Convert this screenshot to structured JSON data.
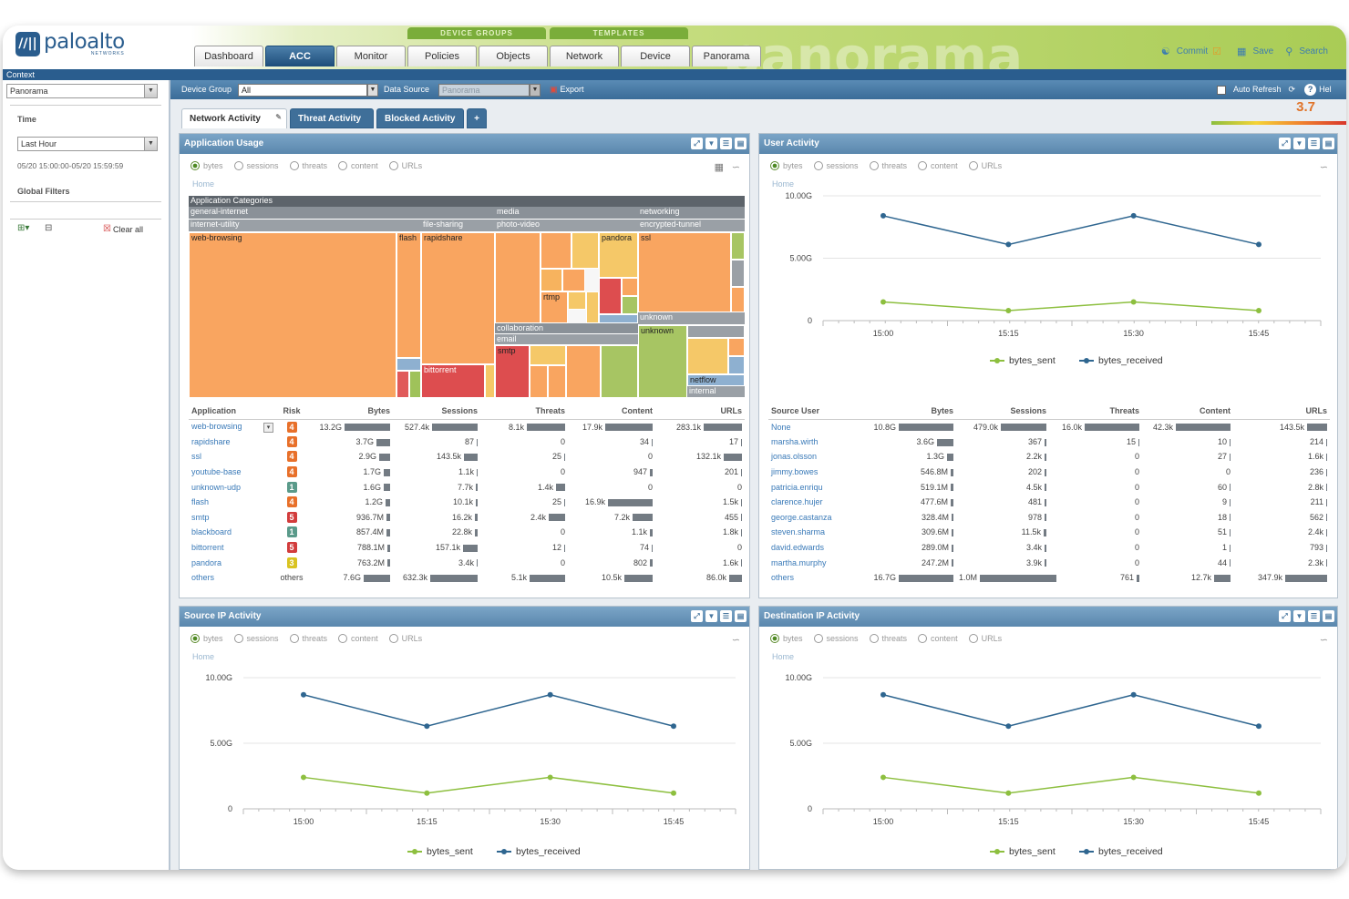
{
  "header": {
    "logo_name": "paloalto",
    "logo_sub": "NETWORKS",
    "logo_mark": "//||",
    "bg_word": "panorama",
    "group_device": "DEVICE GROUPS",
    "group_templates": "TEMPLATES",
    "tabs": [
      {
        "label": "Dashboard"
      },
      {
        "label": "ACC"
      },
      {
        "label": "Monitor"
      },
      {
        "label": "Policies"
      },
      {
        "label": "Objects"
      },
      {
        "label": "Network"
      },
      {
        "label": "Device"
      },
      {
        "label": "Panorama"
      }
    ],
    "active_tab": "ACC",
    "links": {
      "commit": "Commit",
      "save": "Save",
      "search": "Search"
    }
  },
  "context": {
    "label": "Context",
    "value": "Panorama"
  },
  "left": {
    "time_label": "Time",
    "time_value": "Last Hour",
    "time_range": "05/20 15:00:00-05/20 15:59:59",
    "filters_label": "Global Filters",
    "clear_all": "Clear all"
  },
  "toolbar": {
    "device_group_label": "Device Group",
    "device_group_value": "All",
    "data_source_label": "Data Source",
    "data_source_value": "Panorama",
    "export": "Export",
    "auto_refresh": "Auto Refresh",
    "help": "Help"
  },
  "subtabs": [
    "Network Activity",
    "Threat Activity",
    "Blocked Activity",
    "+"
  ],
  "risk_value": "3.7",
  "radios": [
    "bytes",
    "sessions",
    "threats",
    "content",
    "URLs"
  ],
  "home": "Home",
  "app_usage": {
    "title": "Application Usage",
    "treemap_labels": {
      "root": "Application Categories",
      "general_internet": "general-internet",
      "media": "media",
      "networking": "networking",
      "internet_utility": "internet-utility",
      "file_sharing": "file-sharing",
      "photo_video": "photo-video",
      "encrypted_tunnel": "encrypted-tunnel",
      "web_browsing": "web-browsing",
      "flash": "flash",
      "rapidshare": "rapidshare",
      "pandora": "pandora",
      "ssl": "ssl",
      "rtmp": "rtmp",
      "unknown1": "unknown",
      "unknown2": "unknown",
      "collaboration": "collaboration",
      "email": "email",
      "smtp": "smtp",
      "bittorrent": "bittorrent",
      "netflow": "netflow",
      "internal": "internal"
    },
    "columns": [
      "Application",
      "Risk",
      "Bytes",
      "Sessions",
      "Threats",
      "Content",
      "URLs"
    ],
    "rows": [
      {
        "name": "web-browsing",
        "risk": "4",
        "bytes": "13.2G",
        "sessions": "527.4k",
        "threats": "8.1k",
        "content": "17.9k",
        "urls": "283.1k",
        "b": [
          1,
          0.97,
          0.8,
          1,
          1
        ]
      },
      {
        "name": "rapidshare",
        "risk": "4",
        "bytes": "3.7G",
        "sessions": "87",
        "threats": "0",
        "content": "34",
        "urls": "17",
        "b": [
          0.3,
          0.02,
          0,
          0.02,
          0.02
        ]
      },
      {
        "name": "ssl",
        "risk": "4",
        "bytes": "2.9G",
        "sessions": "143.5k",
        "threats": "25",
        "content": "0",
        "urls": "132.1k",
        "b": [
          0.24,
          0.28,
          0.02,
          0,
          0.47
        ]
      },
      {
        "name": "youtube-base",
        "risk": "4",
        "bytes": "1.7G",
        "sessions": "1.1k",
        "threats": "0",
        "content": "947",
        "urls": "201",
        "b": [
          0.14,
          0.02,
          0,
          0.06,
          0.02
        ]
      },
      {
        "name": "unknown-udp",
        "risk": "1",
        "bytes": "1.6G",
        "sessions": "7.7k",
        "threats": "1.4k",
        "content": "0",
        "urls": "0",
        "b": [
          0.13,
          0.03,
          0.2,
          0,
          0
        ]
      },
      {
        "name": "flash",
        "risk": "4",
        "bytes": "1.2G",
        "sessions": "10.1k",
        "threats": "25",
        "content": "16.9k",
        "urls": "1.5k",
        "b": [
          0.1,
          0.04,
          0.02,
          0.95,
          0.02
        ]
      },
      {
        "name": "smtp",
        "risk": "5",
        "bytes": "936.7M",
        "sessions": "16.2k",
        "threats": "2.4k",
        "content": "7.2k",
        "urls": "455",
        "b": [
          0.08,
          0.05,
          0.35,
          0.42,
          0.02
        ]
      },
      {
        "name": "blackboard",
        "risk": "1",
        "bytes": "857.4M",
        "sessions": "22.8k",
        "threats": "0",
        "content": "1.1k",
        "urls": "1.8k",
        "b": [
          0.07,
          0.06,
          0,
          0.06,
          0.02
        ]
      },
      {
        "name": "bittorrent",
        "risk": "5",
        "bytes": "788.1M",
        "sessions": "157.1k",
        "threats": "12",
        "content": "74",
        "urls": "0",
        "b": [
          0.06,
          0.3,
          0.02,
          0.02,
          0
        ]
      },
      {
        "name": "pandora",
        "risk": "3",
        "bytes": "763.2M",
        "sessions": "3.4k",
        "threats": "0",
        "content": "802",
        "urls": "1.6k",
        "b": [
          0.06,
          0.02,
          0,
          0.05,
          0.02
        ]
      },
      {
        "name": "others",
        "risk": "others",
        "bytes": "7.6G",
        "sessions": "632.3k",
        "threats": "5.1k",
        "content": "10.5k",
        "urls": "86.0k",
        "b": [
          0.58,
          1,
          0.75,
          0.6,
          0.33
        ]
      }
    ]
  },
  "user_activity": {
    "title": "User Activity",
    "columns": [
      "Source User",
      "Bytes",
      "Sessions",
      "Threats",
      "Content",
      "URLs"
    ],
    "rows": [
      {
        "name": "None",
        "bytes": "10.8G",
        "sessions": "479.0k",
        "threats": "16.0k",
        "content": "42.3k",
        "urls": "143.5k",
        "b": [
          1,
          0.6,
          1,
          1,
          0.47
        ]
      },
      {
        "name": "marsha.wirth",
        "bytes": "3.6G",
        "sessions": "367",
        "threats": "15",
        "content": "10",
        "urls": "214",
        "b": [
          0.3,
          0.02,
          0.02,
          0.02,
          0.02
        ]
      },
      {
        "name": "jonas.olsson",
        "bytes": "1.3G",
        "sessions": "2.2k",
        "threats": "0",
        "content": "27",
        "urls": "1.6k",
        "b": [
          0.12,
          0.02,
          0,
          0.02,
          0.02
        ]
      },
      {
        "name": "jimmy.bowes",
        "bytes": "546.8M",
        "sessions": "202",
        "threats": "0",
        "content": "0",
        "urls": "236",
        "b": [
          0.05,
          0.02,
          0,
          0,
          0.02
        ]
      },
      {
        "name": "patricia.enriqu",
        "bytes": "519.1M",
        "sessions": "4.5k",
        "threats": "0",
        "content": "60",
        "urls": "2.8k",
        "b": [
          0.05,
          0.02,
          0,
          0.02,
          0.02
        ]
      },
      {
        "name": "clarence.hujer",
        "bytes": "477.6M",
        "sessions": "481",
        "threats": "0",
        "content": "9",
        "urls": "211",
        "b": [
          0.05,
          0.02,
          0,
          0.02,
          0.02
        ]
      },
      {
        "name": "george.castanza",
        "bytes": "328.4M",
        "sessions": "978",
        "threats": "0",
        "content": "18",
        "urls": "562",
        "b": [
          0.04,
          0.02,
          0,
          0.02,
          0.02
        ]
      },
      {
        "name": "steven.sharma",
        "bytes": "309.6M",
        "sessions": "11.5k",
        "threats": "0",
        "content": "51",
        "urls": "2.4k",
        "b": [
          0.04,
          0.03,
          0,
          0.02,
          0.02
        ]
      },
      {
        "name": "david.edwards",
        "bytes": "289.0M",
        "sessions": "3.4k",
        "threats": "0",
        "content": "1",
        "urls": "793",
        "b": [
          0.04,
          0.02,
          0,
          0.02,
          0.02
        ]
      },
      {
        "name": "martha.murphy",
        "bytes": "247.2M",
        "sessions": "3.9k",
        "threats": "0",
        "content": "44",
        "urls": "2.3k",
        "b": [
          0.03,
          0.02,
          0,
          0.02,
          0.02
        ]
      },
      {
        "name": "others",
        "bytes": "16.7G",
        "sessions": "1.0M",
        "threats": "761",
        "content": "12.7k",
        "urls": "347.9k",
        "b": [
          1,
          1,
          0.05,
          0.3,
          1
        ]
      }
    ]
  },
  "source_ip": {
    "title": "Source IP Activity"
  },
  "dest_ip": {
    "title": "Destination IP Activity"
  },
  "chart_data": [
    {
      "type": "line",
      "title": "User Activity",
      "x": [
        "15:00",
        "15:15",
        "15:30",
        "15:45"
      ],
      "yticks": [
        "10.00G",
        "5.00G",
        "0"
      ],
      "ylim": [
        0,
        10
      ],
      "series": [
        {
          "name": "bytes_sent",
          "color": "#8dbf3f",
          "values": [
            1.5,
            0.8,
            1.5,
            0.8
          ]
        },
        {
          "name": "bytes_received",
          "color": "#2f6690",
          "values": [
            8.4,
            6.1,
            8.4,
            6.1
          ]
        }
      ]
    },
    {
      "type": "line",
      "title": "Source IP Activity",
      "x": [
        "15:00",
        "15:15",
        "15:30",
        "15:45"
      ],
      "yticks": [
        "10.00G",
        "5.00G",
        "0"
      ],
      "ylim": [
        0,
        10
      ],
      "series": [
        {
          "name": "bytes_sent",
          "color": "#8dbf3f",
          "values": [
            2.4,
            1.2,
            2.4,
            1.2
          ]
        },
        {
          "name": "bytes_received",
          "color": "#2f6690",
          "values": [
            8.7,
            6.3,
            8.7,
            6.3
          ]
        }
      ]
    },
    {
      "type": "line",
      "title": "Destination IP Activity",
      "x": [
        "15:00",
        "15:15",
        "15:30",
        "15:45"
      ],
      "yticks": [
        "10.00G",
        "5.00G",
        "0"
      ],
      "ylim": [
        0,
        10
      ],
      "series": [
        {
          "name": "bytes_sent",
          "color": "#8dbf3f",
          "values": [
            2.4,
            1.2,
            2.4,
            1.2
          ]
        },
        {
          "name": "bytes_received",
          "color": "#2f6690",
          "values": [
            8.7,
            6.3,
            8.7,
            6.3
          ]
        }
      ]
    }
  ],
  "colors": {
    "risk1": "#5a9a8a",
    "risk3": "#d9c321",
    "risk4": "#e8702a",
    "risk5": "#d23c3c"
  }
}
